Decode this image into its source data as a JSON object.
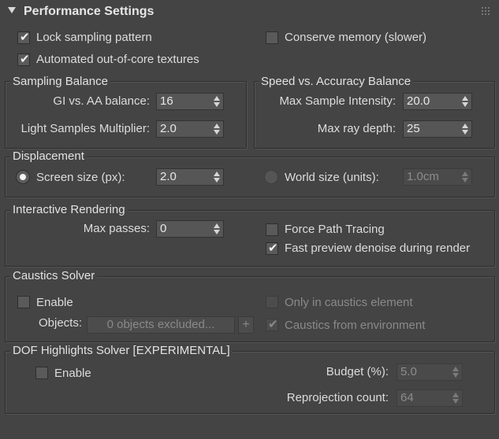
{
  "panel": {
    "title": "Performance Settings"
  },
  "general": {
    "lock_sampling": {
      "label": "Lock sampling pattern",
      "checked": true
    },
    "conserve_memory": {
      "label": "Conserve memory (slower)",
      "checked": false
    },
    "out_of_core": {
      "label": "Automated out-of-core textures",
      "checked": true
    }
  },
  "sampling_balance": {
    "title": "Sampling Balance",
    "gi_aa_label": "GI vs. AA balance:",
    "gi_aa_value": "16",
    "light_samples_label": "Light Samples Multiplier:",
    "light_samples_value": "2.0"
  },
  "speed_accuracy": {
    "title": "Speed vs. Accuracy Balance",
    "max_sample_label": "Max Sample Intensity:",
    "max_sample_value": "20.0",
    "max_ray_label": "Max ray depth:",
    "max_ray_value": "25"
  },
  "displacement": {
    "title": "Displacement",
    "screen_label": "Screen size (px):",
    "screen_value": "2.0",
    "world_label": "World size (units):",
    "world_value": "1.0cm"
  },
  "interactive": {
    "title": "Interactive Rendering",
    "max_passes_label": "Max passes:",
    "max_passes_value": "0",
    "force_path_label": "Force Path Tracing",
    "fast_preview_label": "Fast preview denoise during render"
  },
  "caustics": {
    "title": "Caustics Solver",
    "enable_label": "Enable",
    "objects_label": "Objects:",
    "objects_value": "0 objects excluded...",
    "plus_label": "+",
    "only_caustics_label": "Only in caustics element",
    "from_env_label": "Caustics from environment"
  },
  "dof": {
    "title": "DOF Highlights Solver [EXPERIMENTAL]",
    "enable_label": "Enable",
    "budget_label": "Budget (%):",
    "budget_value": "5.0",
    "reprojection_label": "Reprojection count:",
    "reprojection_value": "64"
  },
  "icons": {
    "check": "✔",
    "collapse": "collapse-arrow-icon",
    "grip": "grip-icon"
  }
}
